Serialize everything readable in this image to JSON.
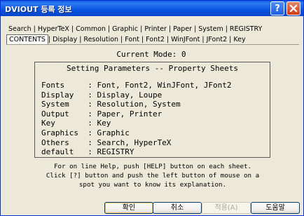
{
  "window": {
    "title": "DVIOUT 등록 정보"
  },
  "titlebar": {
    "help_label": "?"
  },
  "tabs": {
    "row1": [
      "Search",
      "HyperTeX",
      "Common",
      "Graphic",
      "Printer",
      "Paper",
      "System",
      "REGISTRY"
    ],
    "row2": [
      "CONTENTS",
      "Display",
      "Resolution",
      "Font",
      "Font2",
      "WinJFont",
      "JFont2",
      "Key"
    ],
    "active": "CONTENTS"
  },
  "content": {
    "mode": "Current Mode: 0",
    "box_title": "Setting Parameters -- Property Sheets",
    "rows": [
      "Fonts     : Font, Font2, WinJFont, JFont2",
      "Display   : Display, Loupe",
      "System    : Resolution, System",
      "Output    : Paper, Printer",
      "Key       : Key",
      "Graphics  : Graphic",
      "Others    : Search, HyperTeX",
      "default   : REGISTRY"
    ],
    "help_lines": [
      "For on line Help, push [HELP] button on each sheet.",
      "Click [?] button and push the left button of mouse on a",
      "spot you want to know its explanation."
    ]
  },
  "buttons": {
    "ok": "확인",
    "cancel": "취소",
    "apply": "적용(A)",
    "help": "도움말"
  }
}
